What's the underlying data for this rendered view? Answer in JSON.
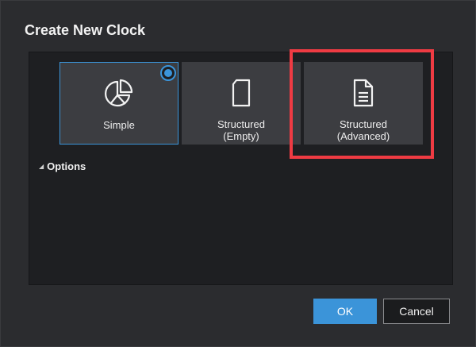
{
  "dialog": {
    "title": "Create New Clock",
    "tiles": [
      {
        "label": "Simple",
        "icon": "pie-chart-icon",
        "selected": true
      },
      {
        "label": "Structured\n(Empty)",
        "icon": "blank-page-icon",
        "selected": false
      },
      {
        "label": "Structured\n(Advanced)",
        "icon": "document-lines-icon",
        "selected": false
      }
    ],
    "options_label": "Options",
    "ok_label": "OK",
    "cancel_label": "Cancel"
  },
  "colors": {
    "accent": "#3b94d9",
    "highlight": "#ef3b43",
    "tile_bg": "#3c3d41",
    "dialog_bg": "#2b2c2f"
  }
}
